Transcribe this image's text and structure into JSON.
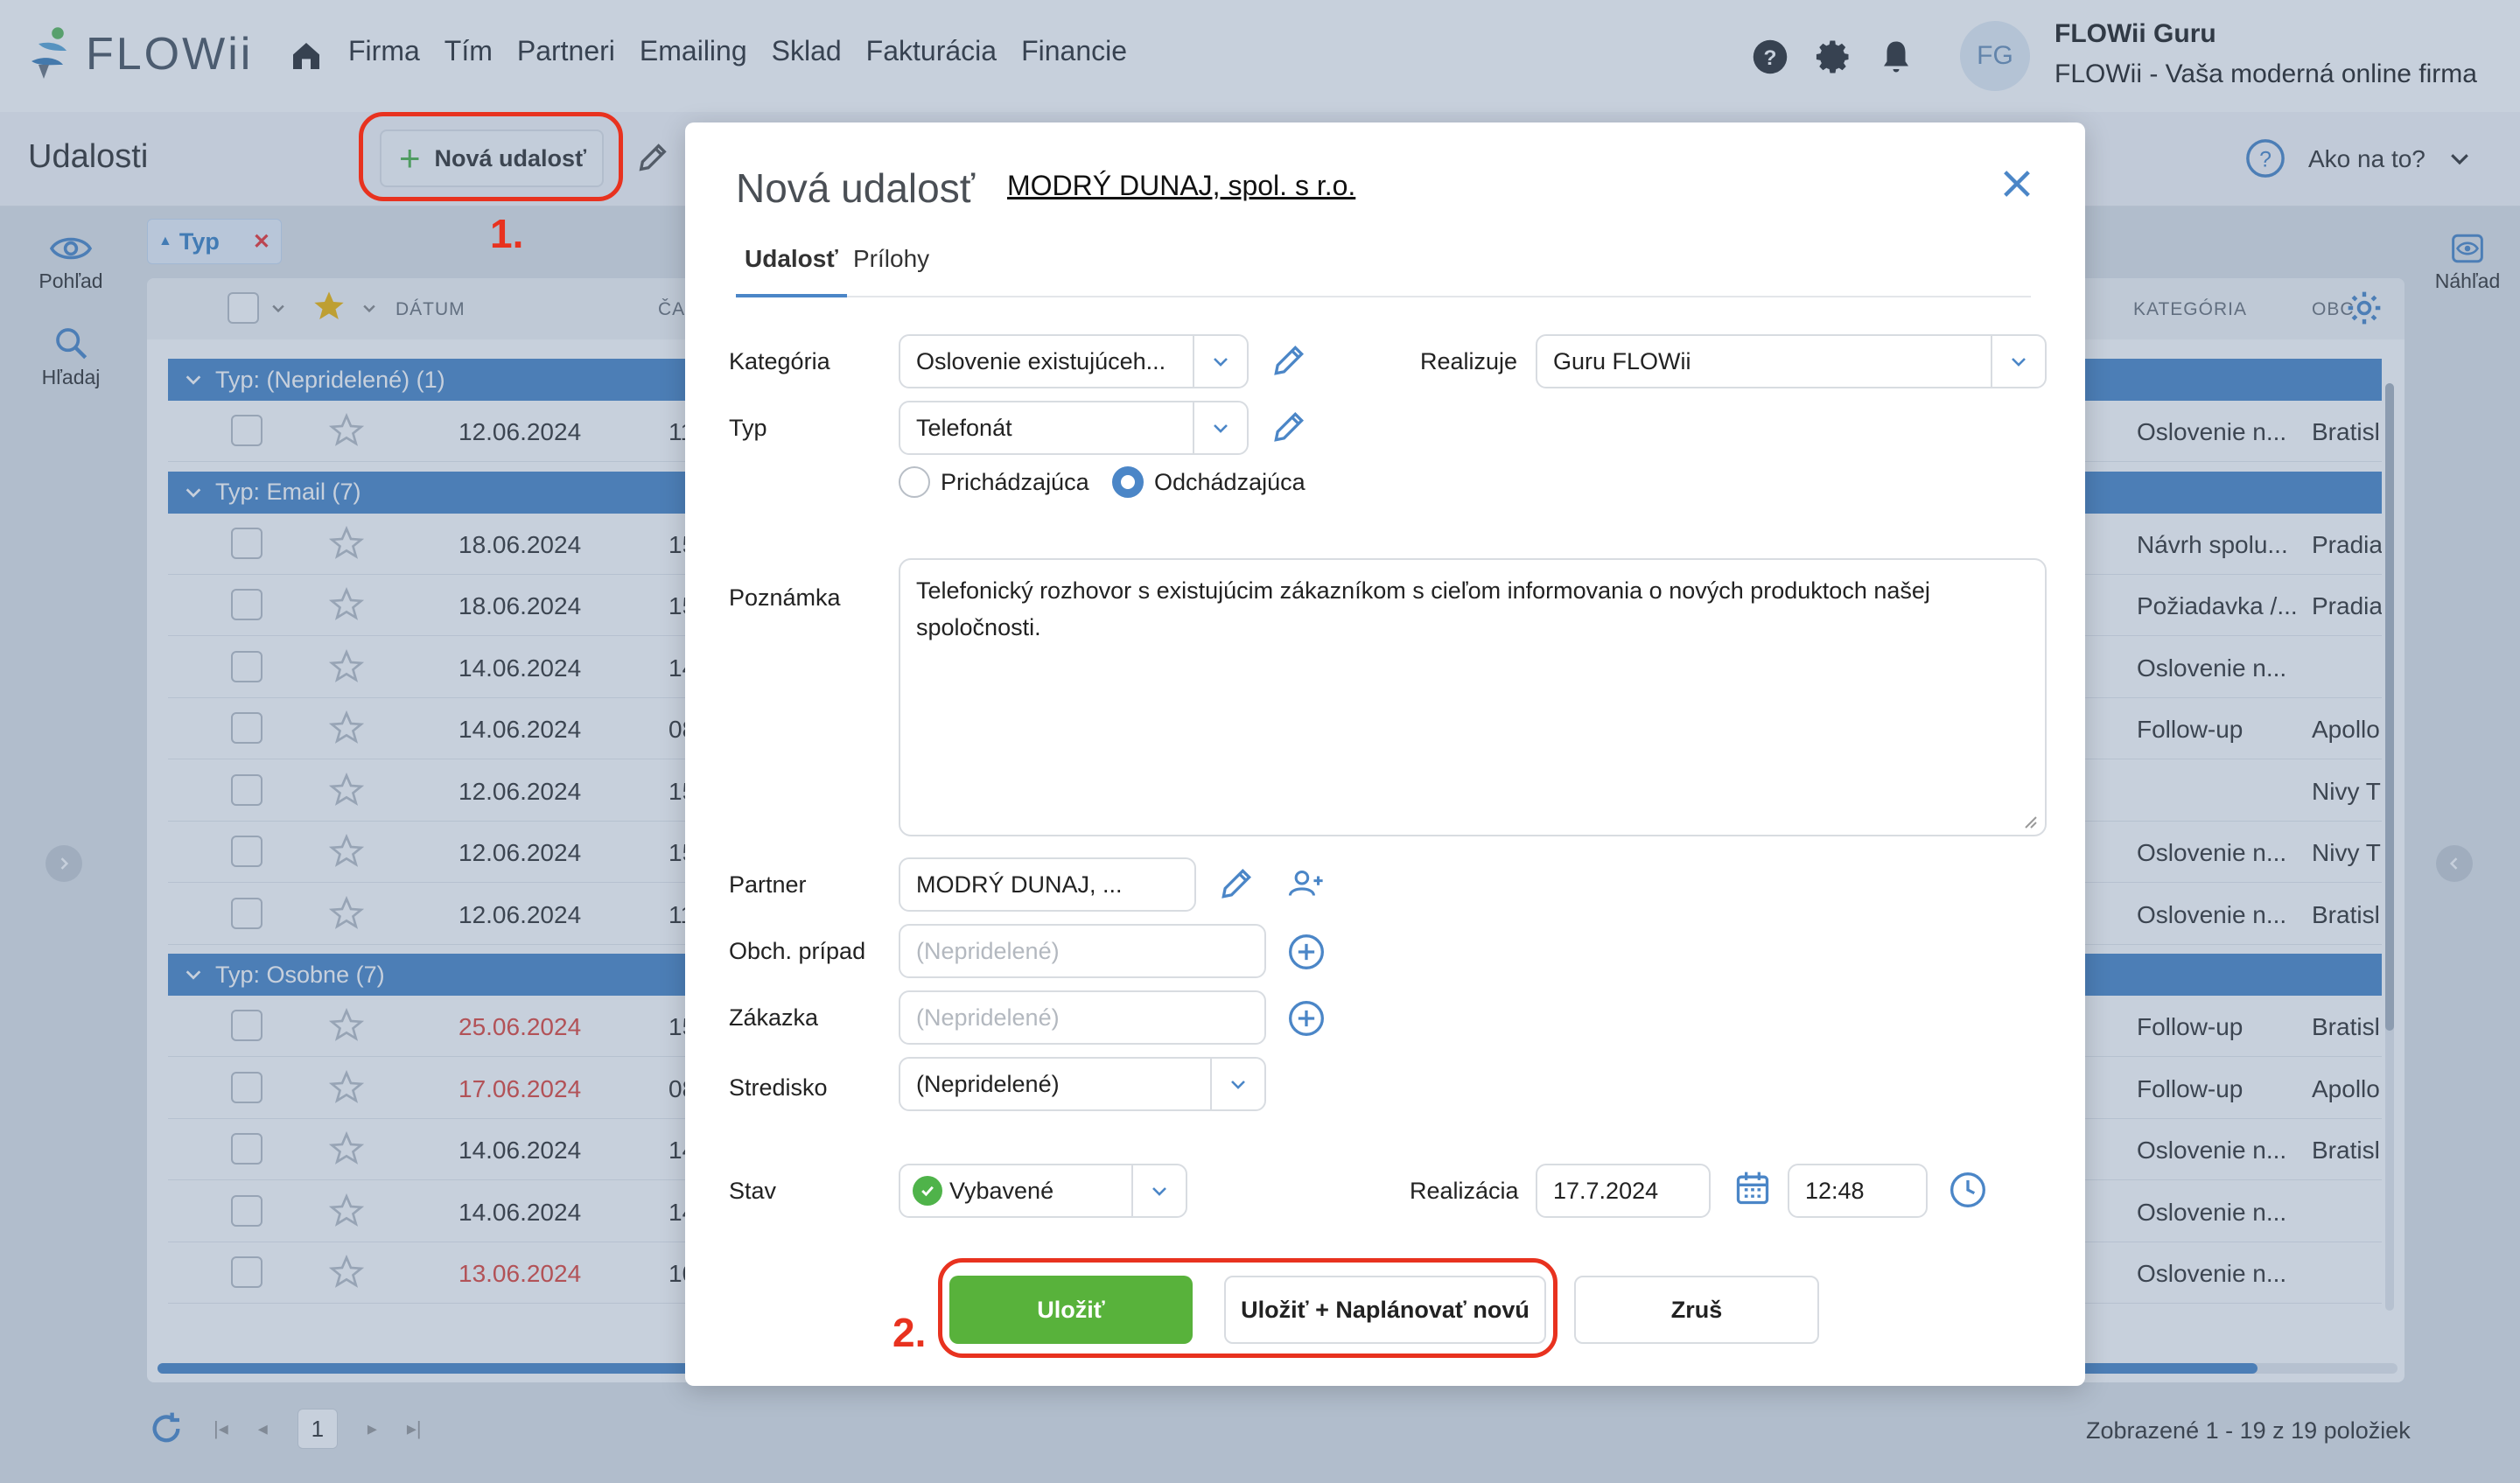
{
  "app": {
    "logo_text": "FLOWii",
    "nav": [
      "Firma",
      "Tím",
      "Partneri",
      "Emailing",
      "Sklad",
      "Fakturácia",
      "Financie"
    ],
    "user": {
      "initials": "FG",
      "name": "FLOWii Guru",
      "company": "FLOWii - Vaša moderná online firma"
    }
  },
  "page": {
    "title": "Udalosti",
    "new_button": "Nová udalosť",
    "howto": "Ako na to?"
  },
  "sidebar": {
    "view_label": "Pohľad",
    "search_label": "Hľadaj",
    "preview_label": "Náhľad"
  },
  "filter_chip": {
    "label": "Typ"
  },
  "grid": {
    "columns": {
      "date": "DÁTUM",
      "time": "ČA",
      "category": "KATEGÓRIA",
      "other": "OBC"
    },
    "groups": [
      {
        "label": "Typ: (Nepridelené) (1)",
        "rows": [
          {
            "date": "12.06.2024",
            "time": "11",
            "category": "Oslovenie n...",
            "place": "Bratisl",
            "overdue": false
          }
        ]
      },
      {
        "label": "Typ: Email (7)",
        "rows": [
          {
            "date": "18.06.2024",
            "time": "15",
            "category": "Návrh spolu...",
            "place": "Pradia",
            "overdue": false
          },
          {
            "date": "18.06.2024",
            "time": "15",
            "category": "Požiadavka /...",
            "place": "Pradia",
            "overdue": false
          },
          {
            "date": "14.06.2024",
            "time": "14",
            "category": "Oslovenie n...",
            "place": "",
            "overdue": false
          },
          {
            "date": "14.06.2024",
            "time": "08",
            "category": "Follow-up",
            "place": "Apollo",
            "overdue": false
          },
          {
            "date": "12.06.2024",
            "time": "15",
            "category": "",
            "place": "Nivy T",
            "overdue": false
          },
          {
            "date": "12.06.2024",
            "time": "15",
            "category": "Oslovenie n...",
            "place": "Nivy T",
            "overdue": false
          },
          {
            "date": "12.06.2024",
            "time": "11",
            "category": "Oslovenie n...",
            "place": "Bratisl",
            "overdue": false
          }
        ]
      },
      {
        "label": "Typ: Osobne (7)",
        "rows": [
          {
            "date": "25.06.2024",
            "time": "15",
            "category": "Follow-up",
            "place": "Bratisl",
            "overdue": true
          },
          {
            "date": "17.06.2024",
            "time": "08",
            "category": "Follow-up",
            "place": "Apollo",
            "overdue": true
          },
          {
            "date": "14.06.2024",
            "time": "14",
            "category": "Oslovenie n...",
            "place": "Bratisl",
            "overdue": false
          },
          {
            "date": "14.06.2024",
            "time": "14",
            "category": "Oslovenie n...",
            "place": "",
            "overdue": false
          },
          {
            "date": "13.06.2024",
            "time": "10",
            "category": "Oslovenie n...",
            "place": "",
            "overdue": true
          }
        ]
      }
    ]
  },
  "pager": {
    "page": "1",
    "info": "Zobrazené 1 - 19 z 19 položiek"
  },
  "modal": {
    "title": "Nová udalosť",
    "partner_link": "MODRÝ DUNAJ, spol. s r.o.",
    "tabs": [
      "Udalosť",
      "Prílohy"
    ],
    "labels": {
      "category": "Kategória",
      "type": "Typ",
      "note": "Poznámka",
      "partner": "Partner",
      "case": "Obch. prípad",
      "order": "Zákazka",
      "center": "Stredisko",
      "status": "Stav",
      "assignee": "Realizuje",
      "realization": "Realizácia"
    },
    "values": {
      "category": "Oslovenie existujúceh...",
      "type": "Telefonát",
      "assignee": "Guru FLOWii",
      "note": "Telefonický rozhovor s existujúcim zákazníkom s cieľom informovania o nových produktoch našej spoločnosti.",
      "partner": "MODRÝ DUNAJ, ...",
      "case_placeholder": "(Nepridelené)",
      "order_placeholder": "(Nepridelené)",
      "center": "(Nepridelené)",
      "status": "Vybavené",
      "date": "17.7.2024",
      "time": "12:48"
    },
    "direction": {
      "incoming": "Prichádzajúca",
      "outgoing": "Odchádzajúca",
      "selected": "outgoing"
    },
    "buttons": {
      "save": "Uložiť",
      "save_plan": "Uložiť + Naplánovať novú",
      "cancel": "Zruš"
    }
  },
  "annotations": {
    "step1": "1.",
    "step2": "2."
  },
  "colors": {
    "accent": "#4b86c7",
    "save": "#58b23b",
    "callout": "#e8321f",
    "overdue": "#e0463c"
  }
}
